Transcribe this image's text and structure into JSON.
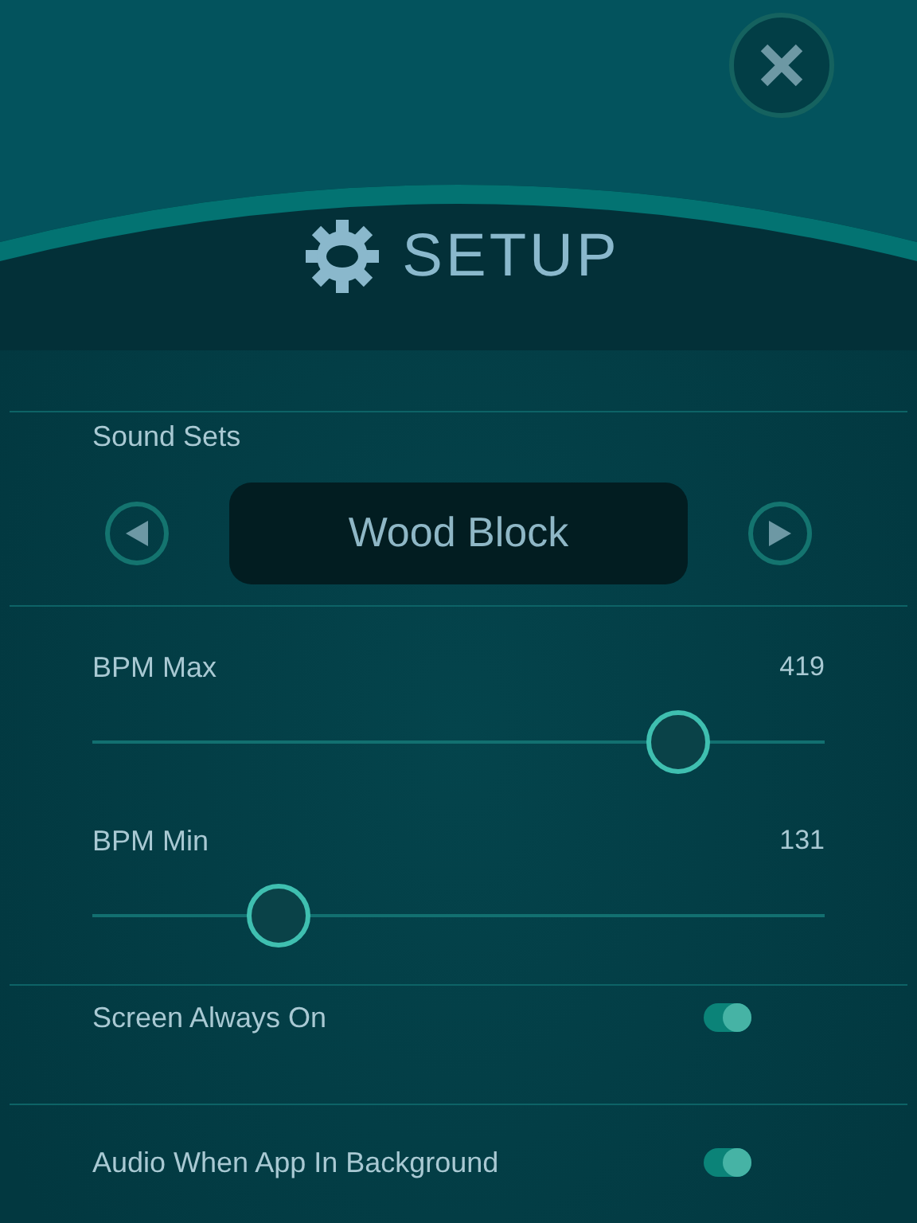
{
  "title": "SETUP",
  "sound_sets": {
    "label": "Sound Sets",
    "value": "Wood Block"
  },
  "sliders": [
    {
      "label": "BPM Max",
      "reading": "419",
      "level": 0.8
    },
    {
      "label": "BPM Min",
      "reading": "131",
      "level": 0.254
    }
  ],
  "toggles": [
    {
      "label": "Screen Always On",
      "on": true
    },
    {
      "label": "Audio When App In Background",
      "on": true
    }
  ]
}
